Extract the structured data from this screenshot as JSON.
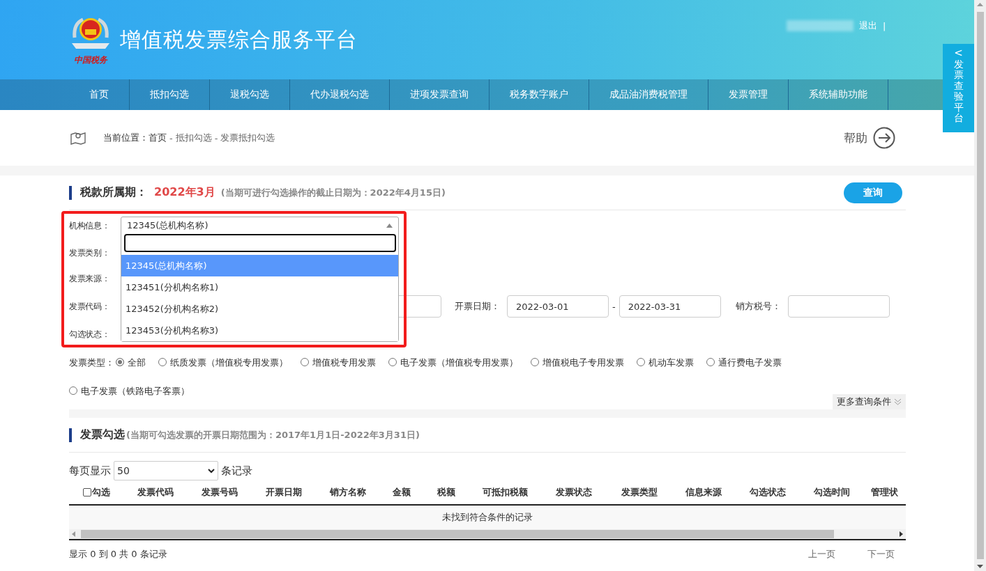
{
  "header": {
    "logo_text": "中国税务",
    "title": "增值税发票综合服务平台",
    "logout": "退出",
    "separator": "|"
  },
  "nav": [
    {
      "label": "首页",
      "selected": false
    },
    {
      "label": "抵扣勾选",
      "selected": false
    },
    {
      "label": "退税勾选",
      "selected": false
    },
    {
      "label": "代办退税勾选",
      "selected": false
    },
    {
      "label": "进项发票查询",
      "selected": false
    },
    {
      "label": "税务数字账户",
      "selected": false
    },
    {
      "label": "成品油消费税管理",
      "selected": false
    },
    {
      "label": "发票管理",
      "selected": false
    },
    {
      "label": "系统辅助功能",
      "selected": false
    }
  ],
  "side_tab": {
    "arrow": "<",
    "label": "发票查验平台"
  },
  "breadcrumb": {
    "prefix": "当前位置：",
    "items": [
      "首页",
      "抵扣勾选",
      "发票抵扣勾选"
    ],
    "separator": "-",
    "help": "帮助"
  },
  "period": {
    "label": "税款所属期：",
    "value": "2022年3月",
    "note": "(当期可进行勾选操作的截止日期为：2022年4月15日)",
    "query_button": "查询"
  },
  "form": {
    "org_label": "机构信息：",
    "org_value": "12345(总机构名称)",
    "org_dropdown": {
      "options": [
        {
          "label": "12345(总机构名称)",
          "selected": true
        },
        {
          "label": "123451(分机构名称1)",
          "selected": false
        },
        {
          "label": "123452(分机构名称2)",
          "selected": false
        },
        {
          "label": "123453(分机构名称3)",
          "selected": false
        }
      ]
    },
    "category_label": "发票类别：",
    "source_label": "发票来源：",
    "code_label": "发票代码：",
    "date_label": "开票日期：",
    "date_from": "2022-03-01",
    "date_dash": "-",
    "date_to": "2022-03-31",
    "seller_tax_label": "销方税号：",
    "status_label": "勾选状态：",
    "type_label": "发票类型：",
    "types": [
      {
        "label": "全部",
        "selected": true
      },
      {
        "label": "纸质发票（增值税专用发票）",
        "selected": false
      },
      {
        "label": "增值税专用发票",
        "selected": false
      },
      {
        "label": "电子发票（增值税专用发票）",
        "selected": false
      },
      {
        "label": "增值税电子专用发票",
        "selected": false
      },
      {
        "label": "机动车发票",
        "selected": false
      },
      {
        "label": "通行费电子发票",
        "selected": false
      },
      {
        "label": "电子发票（铁路电子客票）",
        "selected": false
      }
    ],
    "more_conditions": "更多查询条件"
  },
  "selection": {
    "title": "发票勾选",
    "note": "(当期可勾选发票的开票日期范围为：2017年1月1日-2022年3月31日)",
    "page_size_prefix": "每页显示",
    "page_size": "50",
    "page_size_suffix": "条记录",
    "select_all_checked": false,
    "columns": [
      "勾选",
      "发票代码",
      "发票号码",
      "开票日期",
      "销方名称",
      "金额",
      "税额",
      "可抵扣税额",
      "发票状态",
      "发票类型",
      "信息来源",
      "勾选状态",
      "勾选时间",
      "管理状"
    ],
    "empty": "未找到符合条件的记录",
    "summary": "显示 0 到 0 共 0 条记录",
    "prev": "上一页",
    "next": "下一页"
  }
}
